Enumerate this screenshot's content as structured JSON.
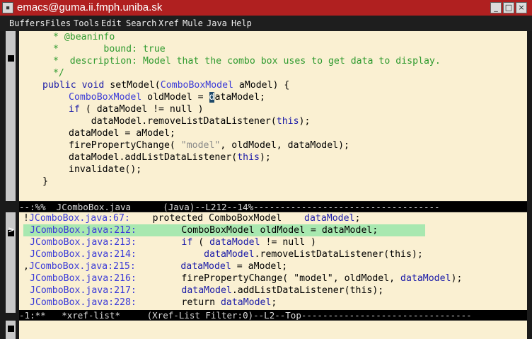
{
  "window": {
    "title": "emacs@guma.ii.fmph.uniba.sk"
  },
  "menu": [
    "Buffers",
    "Files",
    "Tools",
    "Edit",
    "Search",
    "Xref",
    "Mule",
    "Java",
    "Help"
  ],
  "code": {
    "l1": " * @beaninfo",
    "l2": " *        bound: true",
    "l3": " *  description: Model that the combo box uses to get data to display.",
    "l4": " */",
    "l5_kw": "public void",
    "l5_name": " setModel(",
    "l5_type": "ComboBoxModel",
    "l5_rest": " aModel) {",
    "l6_type": "ComboBoxModel",
    "l6_a": " oldModel = ",
    "l6_cursor": "d",
    "l6_b": "ataModel;",
    "l7_kw": "if",
    "l7_rest": " ( dataModel != null )",
    "l8_a": "    dataModel.removeListDataListener(",
    "l8_kw": "this",
    "l8_b": ");",
    "l9": "dataModel = aModel;",
    "l10_a": "firePropertyChange( ",
    "l10_str": "\"model\"",
    "l10_b": ", oldModel, dataModel);",
    "l11_a": "dataModel.addListDataListener(",
    "l11_kw": "this",
    "l11_b": ");",
    "l12": "invalidate();",
    "l13": "}"
  },
  "modeline_top": "--:%%  JComboBox.java      (Java)--L212--14%-----------------------------------",
  "xref": {
    "r1_mark": "!",
    "r1_file": "JComboBox.java:67:",
    "r1_code": "    protected ComboBoxModel    ",
    "r1_hl": "dataModel",
    "r1_end": ";",
    "r2_mark": "",
    "r2_file": "JComboBox.java:212:",
    "r2_code": "        ComboBoxModel oldModel = dataModel;",
    "r3_file": "JComboBox.java:213:",
    "r3_kw": "        if",
    "r3_a": " ( ",
    "r3_hl": "dataModel",
    "r3_b": " != null )",
    "r4_file": "JComboBox.java:214:",
    "r4_a": "            ",
    "r4_hl": "dataModel",
    "r4_b": ".removeListDataListener(this);",
    "r5_mark": ",",
    "r5_file": "JComboBox.java:215:",
    "r5_a": "        ",
    "r5_hl": "dataModel",
    "r5_b": " = aModel;",
    "r6_file": "JComboBox.java:216:",
    "r6_a": "        firePropertyChange( \"model\", oldModel, ",
    "r6_hl": "dataModel",
    "r6_b": ");",
    "r7_file": "JComboBox.java:217:",
    "r7_a": "        ",
    "r7_hl": "dataModel",
    "r7_b": ".addListDataListener(this);",
    "r8_file": "JComboBox.java:228:",
    "r8_a": "        return ",
    "r8_hl": "dataModel",
    "r8_b": ";"
  },
  "current_marker": ">",
  "modeline_bottom": "-1:**   *xref-list*     (Xref-List Filter:0)--L2--Top--------------------------------"
}
